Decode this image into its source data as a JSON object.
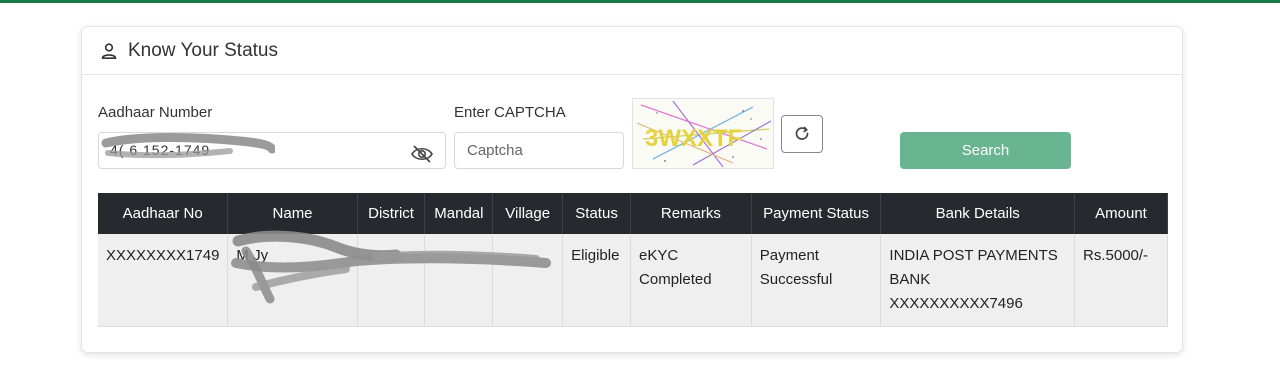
{
  "colors": {
    "accent_bar": "#1a7a45",
    "search_button": "#69b592",
    "table_header": "#262a2e"
  },
  "card": {
    "title": "Know Your Status",
    "icon": "user-icon"
  },
  "form": {
    "aadhaar_label": "Aadhaar Number",
    "aadhaar_value": "4(  6  152-1749",
    "captcha_label": "Enter CAPTCHA",
    "captcha_placeholder": "Captcha",
    "captcha_text": "3WXXTF",
    "search_label": "Search"
  },
  "table": {
    "headers": [
      "Aadhaar No",
      "Name",
      "District",
      "Mandal",
      "Village",
      "Status",
      "Remarks",
      "Payment Status",
      "Bank Details",
      "Amount"
    ],
    "rows": [
      {
        "aadhaar_no": "XXXXXXXX1749",
        "name": "M Jy",
        "district": "",
        "mandal": "",
        "village": "",
        "status": "Eligible",
        "remarks": "eKYC Completed",
        "payment_status": "Payment Successful",
        "bank_details": "INDIA POST PAYMENTS BANK XXXXXXXXXX7496",
        "amount": "Rs.5000/-"
      }
    ]
  }
}
